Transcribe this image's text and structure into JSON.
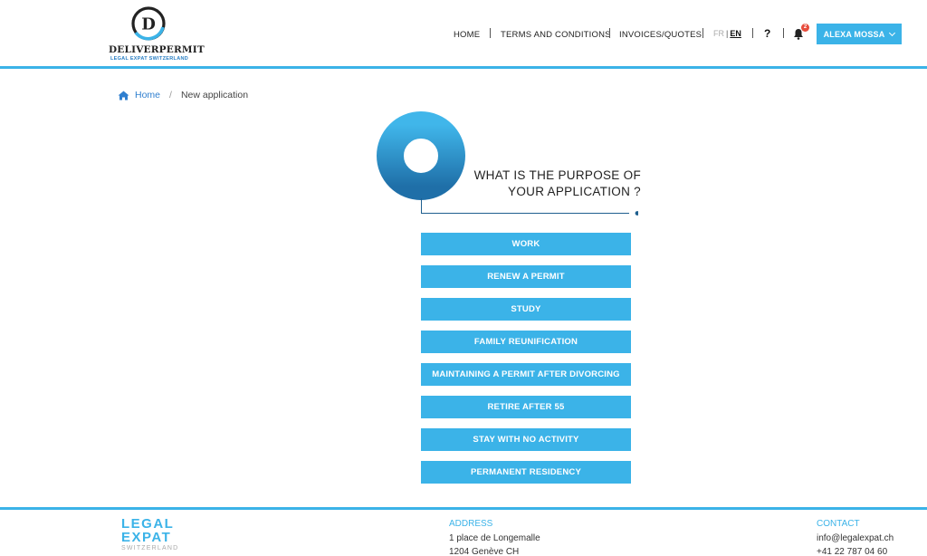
{
  "brand": {
    "logo_letter": "D",
    "name": "DELIVERPERMIT",
    "tagline": "LEGAL EXPAT SWITZERLAND",
    "accent": "#3bb3e8",
    "dark_blue": "#1f5f8f"
  },
  "nav": {
    "home": "HOME",
    "terms": "TERMS AND CONDITIONS",
    "invoices": "INVOICES/QUOTES",
    "lang_fr": "FR",
    "lang_sep": "|",
    "lang_en": "EN",
    "help": "?",
    "notifications_count": "2",
    "user": "ALEXA MOSSA"
  },
  "breadcrumb": {
    "home": "Home",
    "separator": "/",
    "current": "New application"
  },
  "question": {
    "line1": "WHAT IS THE PURPOSE OF",
    "line2": "YOUR APPLICATION ?"
  },
  "options": [
    "WORK",
    "RENEW A PERMIT",
    "STUDY",
    "FAMILY REUNIFICATION",
    "MAINTAINING A PERMIT AFTER DIVORCING",
    "RETIRE AFTER 55",
    "STAY WITH NO ACTIVITY",
    "PERMANENT RESIDENCY"
  ],
  "footer": {
    "logo_line1": "LEGAL",
    "logo_line2": "EXPAT",
    "logo_line3": "SWITZERLAND",
    "address_title": "ADDRESS",
    "address_line1": "1 place de Longemalle",
    "address_line2": "1204 Genève CH",
    "contact_title": "CONTACT",
    "email": "info@legalexpat.ch",
    "phone": "+41 22 787 04 60"
  },
  "icons": {
    "home": "home-icon",
    "bell": "bell-icon",
    "chevron": "chevron-down-icon"
  }
}
